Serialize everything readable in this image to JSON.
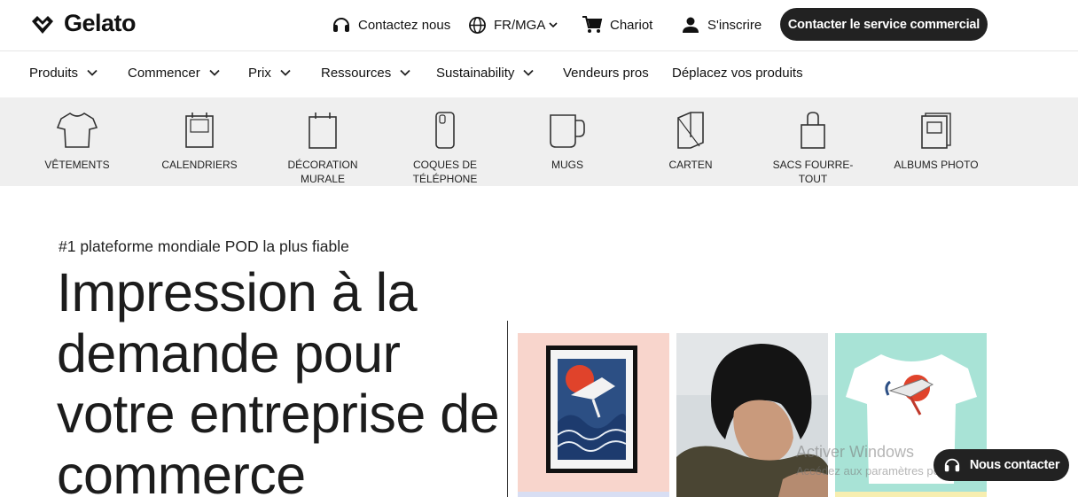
{
  "brand": {
    "name": "Gelato"
  },
  "topbar": {
    "contact_label": "Contactez nous",
    "locale_label": "FR/MGA",
    "cart_label": "Chariot",
    "signup_label": "S'inscrire",
    "cta_label": "Contacter le service commercial"
  },
  "nav": {
    "items": [
      {
        "label": "Produits"
      },
      {
        "label": "Commencer"
      },
      {
        "label": "Prix"
      },
      {
        "label": "Ressources"
      },
      {
        "label": "Sustainability"
      },
      {
        "label": "Vendeurs pros"
      },
      {
        "label": "Déplacez vos produits"
      }
    ]
  },
  "categories": [
    {
      "label": "VÊTEMENTS",
      "icon": "tshirt-icon"
    },
    {
      "label": "CALENDRIERS",
      "icon": "calendar-icon"
    },
    {
      "label": "DÉCORATION MURALE",
      "icon": "wall-frame-icon"
    },
    {
      "label": "COQUES DE TÉLÉPHONE",
      "icon": "phone-case-icon"
    },
    {
      "label": "MUGS",
      "icon": "mug-icon"
    },
    {
      "label": "CARTEN",
      "icon": "card-icon"
    },
    {
      "label": "SACS FOURRE-TOUT",
      "icon": "tote-bag-icon"
    },
    {
      "label": "ALBUMS PHOTO",
      "icon": "photo-album-icon"
    }
  ],
  "hero": {
    "eyebrow": "#1 plateforme mondiale POD la plus fiable",
    "title": "Impression à la demande pour votre entreprise de commerce"
  },
  "watermark": {
    "line1": "Activer Windows",
    "line2": "Accédez aux paramètres pour activer Windows."
  },
  "chat": {
    "label": "Nous contacter"
  },
  "colors": {
    "dark": "#222222",
    "catbar_bg": "#efefef",
    "tile_pink": "#f8d5cc",
    "tile_mint": "#a8e3d6"
  }
}
